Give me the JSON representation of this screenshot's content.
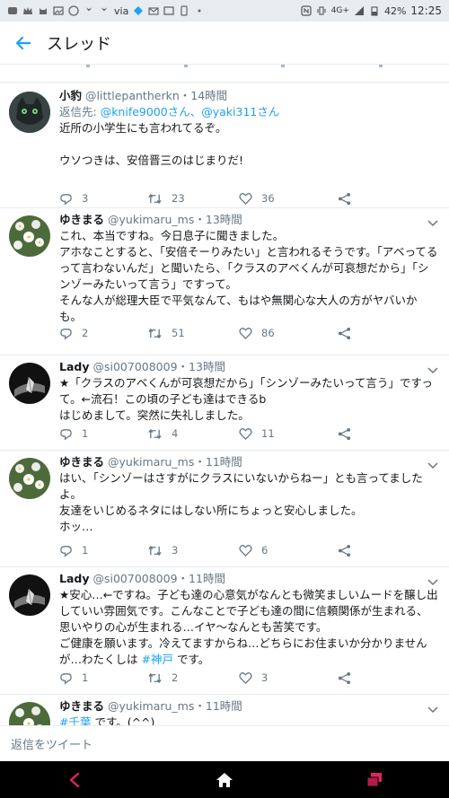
{
  "status_bar": {
    "network": "via",
    "signal": "4G+",
    "battery": "42%",
    "time": "12:25"
  },
  "header": {
    "title": "スレッド"
  },
  "tweets": [
    {
      "name": "小豹",
      "handle": "@littlepantherkn",
      "time": "・14時間",
      "reply_prefix": "返信先: ",
      "reply_mentions": "@knife9000さん、@yaki311さん",
      "text": "近所の小学生にも言われてるぞ。\n\nウソつきは、安倍晋三のはじまりだ!",
      "replies": "3",
      "retweets": "23",
      "likes": "36"
    },
    {
      "name": "ゆきまる",
      "handle": "@yukimaru_ms",
      "time": "・13時間",
      "text": "これ、本当ですね。今日息子に聞きました。\nアホなことすると、「安倍そーりみたい」と言われるそうです。「アベってるって言わないんだ」と聞いたら、「クラスのアベくんが可哀想だから」「シンゾーみたいって言う」ですって。\nそんな人が総理大臣で平気なんて、もはや無関心な大人の方がヤバいかも。",
      "replies": "2",
      "retweets": "51",
      "likes": "86"
    },
    {
      "name": "Lady",
      "handle": "@si007008009",
      "time": "・13時間",
      "text": "★「クラスのアベくんが可哀想だから」「シンゾーみたいって言う」ですって。←流石！この頃の子ども達はできるb\nはじめまして。突然に失礼しました。",
      "replies": "1",
      "retweets": "4",
      "likes": "11"
    },
    {
      "name": "ゆきまる",
      "handle": "@yukimaru_ms",
      "time": "・11時間",
      "text": "はい、「シンゾーはさすがにクラスにいないからねー」とも言ってましたよ。\n友達をいじめるネタにはしない所にちょっと安心しました。\nホッ…",
      "replies": "1",
      "retweets": "3",
      "likes": "6"
    },
    {
      "name": "Lady",
      "handle": "@si007008009",
      "time": "・11時間",
      "text_before_tag": "★安心…←ですね。子ども達の心意気がなんとも微笑ましいムードを醸し出していい雰囲気です。こんなことで子ども達の間に信頼関係が生まれる、思いやりの心が生まれる…イヤ〜なんとも苦笑です。\nご健康を願います。冷えてますからね…どちらにお住まいか分かりませんが…わたくしは ",
      "hashtag": "#神戸",
      "text_after_tag": " です。",
      "replies": "1",
      "retweets": "2",
      "likes": "3"
    },
    {
      "name": "ゆきまる",
      "handle": "@yukimaru_ms",
      "time": "・11時間",
      "hashtag": "#千葉",
      "text_after_tag": " です。(^^)\n中学校では、朝、気になるニュース等を一日一人ずつ発表するそうで、そ"
    }
  ],
  "reply_bar": {
    "placeholder": "返信をツイート"
  },
  "colors": {
    "accent": "#1da1f2",
    "secondary_text": "#657786",
    "divider": "#e6ecf0",
    "nav_back": "#e0245e"
  },
  "icons": [
    "back-arrow-icon",
    "reply-icon",
    "retweet-icon",
    "like-icon",
    "share-icon",
    "chevron-down-icon",
    "nav-back-icon",
    "nav-home-icon",
    "nav-recents-icon"
  ]
}
